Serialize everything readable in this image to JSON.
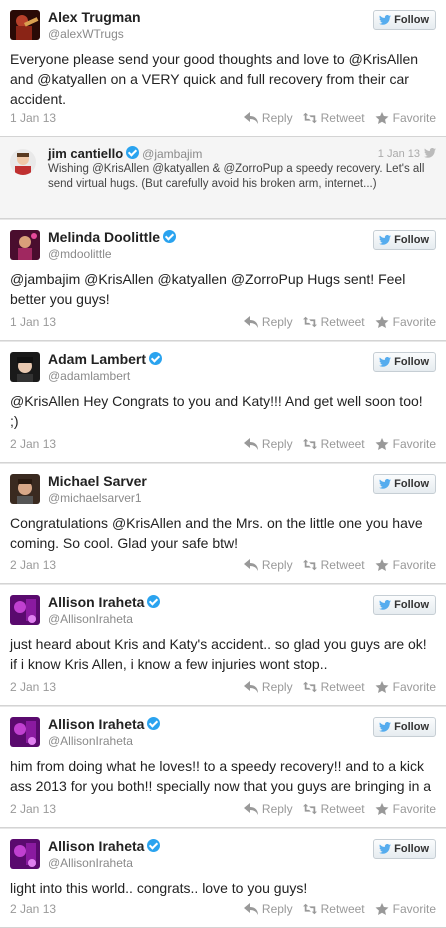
{
  "colors": {
    "accent": "#2aa3ef",
    "meta": "#999999",
    "follow_bird": "#55acee"
  },
  "action_labels": {
    "reply": "Reply",
    "retweet": "Retweet",
    "favorite": "Favorite",
    "follow": "Follow"
  },
  "tweets": [
    {
      "name": "Alex Trugman",
      "handle": "@alexWTrugs",
      "verified": false,
      "text": "Everyone please send your good thoughts and love to @KrisAllen and @katyallen on a VERY quick and full recovery from their car accident.",
      "date": "1 Jan 13",
      "avatar_icon": "guitarist-avatar"
    },
    {
      "name": "Melinda Doolittle",
      "handle": "@mdoolittle",
      "verified": true,
      "text": "@jambajim @KrisAllen @katyallen @ZorroPup Hugs sent! Feel better you guys!",
      "date": "1 Jan 13",
      "avatar_icon": "singer-avatar"
    },
    {
      "name": "Adam Lambert",
      "handle": "@adamlambert",
      "verified": true,
      "text": "@KrisAllen Hey Congrats to you and Katy!!! And get well soon too! ;)",
      "date": "2 Jan 13",
      "avatar_icon": "portrait-avatar"
    },
    {
      "name": "Michael Sarver",
      "handle": "@michaelsarver1",
      "verified": false,
      "text": "Congratulations @KrisAllen and the Mrs. on the little one you have coming. So cool. Glad your safe btw!",
      "date": "2 Jan 13",
      "avatar_icon": "portrait-avatar"
    },
    {
      "name": "Allison Iraheta",
      "handle": "@AllisonIraheta",
      "verified": true,
      "text": "just heard about Kris and Katy's accident.. so glad you guys are ok! if i know Kris Allen, i know a few injuries wont stop..",
      "date": "2 Jan 13",
      "avatar_icon": "purple-avatar"
    },
    {
      "name": "Allison Iraheta",
      "handle": "@AllisonIraheta",
      "verified": true,
      "text": "him from doing what he loves!! to a speedy recovery!! and to a kick ass 2013 for you both!! specially now that you guys are bringing in a",
      "date": "2 Jan 13",
      "avatar_icon": "purple-avatar"
    },
    {
      "name": "Allison Iraheta",
      "handle": "@AllisonIraheta",
      "verified": true,
      "text": "light into this world.. congrats.. love to you guys!",
      "date": "2 Jan 13",
      "avatar_icon": "purple-avatar"
    }
  ],
  "embedded_reply": {
    "name": "jim cantiello",
    "handle": "@jambajim",
    "verified": true,
    "date": "1 Jan 13",
    "text": "Wishing @KrisAllen @katyallen & @ZorroPup a speedy recovery. Let's all send virtual hugs. (But carefully avoid his broken arm, internet...)"
  }
}
